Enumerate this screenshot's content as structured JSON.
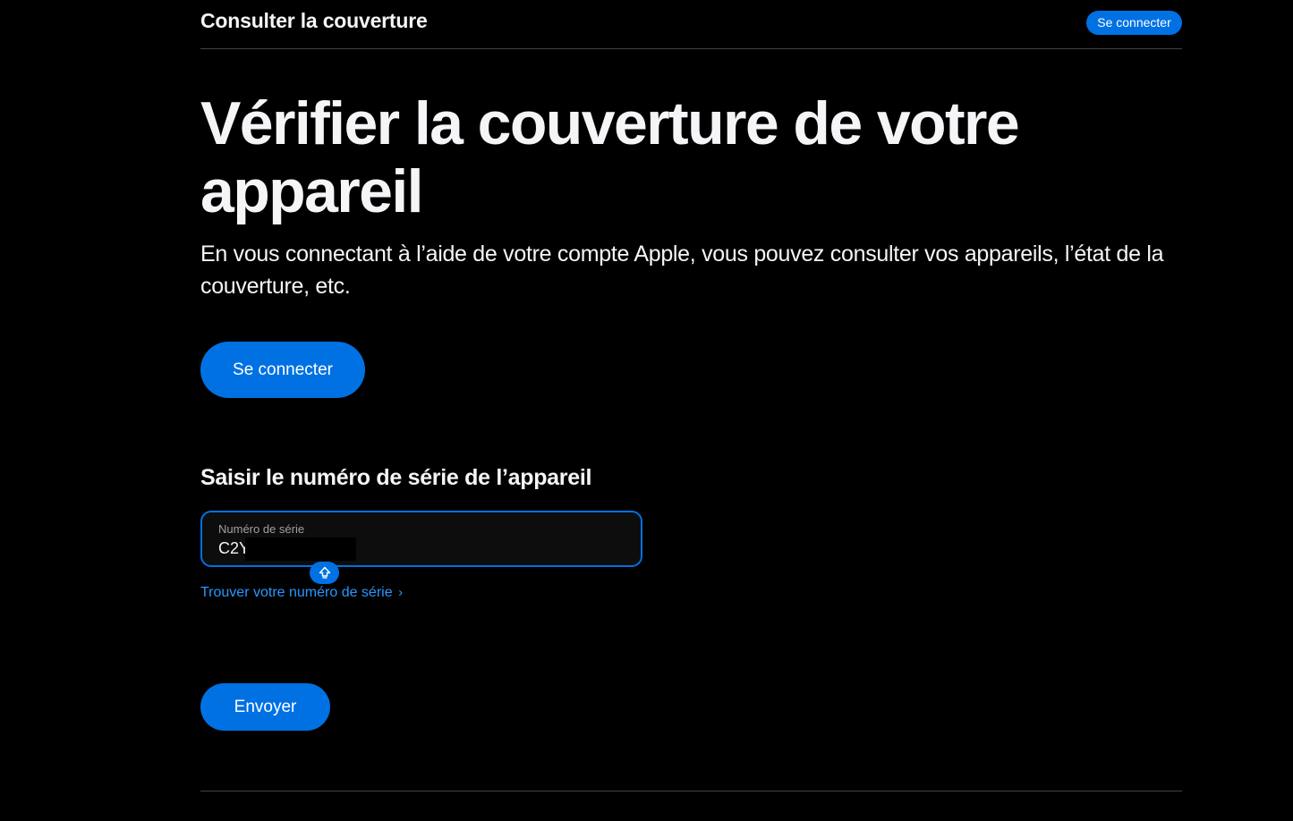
{
  "header": {
    "title": "Consulter la couverture",
    "signin_label": "Se connecter"
  },
  "hero": {
    "title": "Vérifier la couverture de votre appareil",
    "subtitle": "En vous connectant à l’aide de votre compte Apple, vous pouvez consulter vos appareils, l’état de la couverture, etc.",
    "signin_label": "Se connecter"
  },
  "serial_section": {
    "heading": "Saisir le numéro de série de l’appareil",
    "field_label": "Numéro de série",
    "field_value": "C2Y",
    "caps_lock_icon": "caps-lock-icon",
    "find_link_label": "Trouver votre numéro de série",
    "find_link_icon": "chevron-right-icon",
    "submit_label": "Envoyer"
  },
  "colors": {
    "background": "#000000",
    "accent": "#0071e3",
    "link": "#2997ff",
    "text": "#f5f5f7",
    "divider": "#424245"
  }
}
